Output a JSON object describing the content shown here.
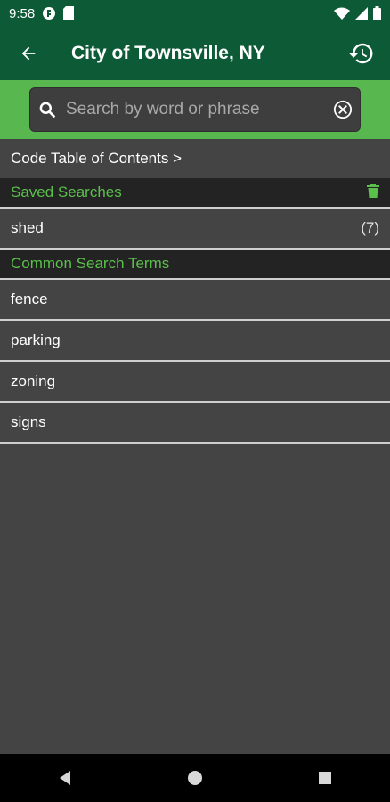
{
  "status_bar": {
    "time": "9:58"
  },
  "app_bar": {
    "title": "City of Townsville, NY",
    "back_icon": "arrow-left-icon",
    "history_icon": "history-icon"
  },
  "search": {
    "placeholder": "Search by word or phrase",
    "value": ""
  },
  "toc": {
    "label": "Code Table of Contents >"
  },
  "saved_searches": {
    "header": "Saved Searches",
    "items": [
      {
        "term": "shed",
        "count": "(7)"
      }
    ]
  },
  "common_terms": {
    "header": "Common Search Terms",
    "items": [
      {
        "term": "fence"
      },
      {
        "term": "parking"
      },
      {
        "term": "zoning"
      },
      {
        "term": "signs"
      }
    ]
  },
  "colors": {
    "app_bar": "#0d5a37",
    "accent_green": "#59b74f",
    "section_text": "#5bbf4c",
    "background": "#444444"
  }
}
